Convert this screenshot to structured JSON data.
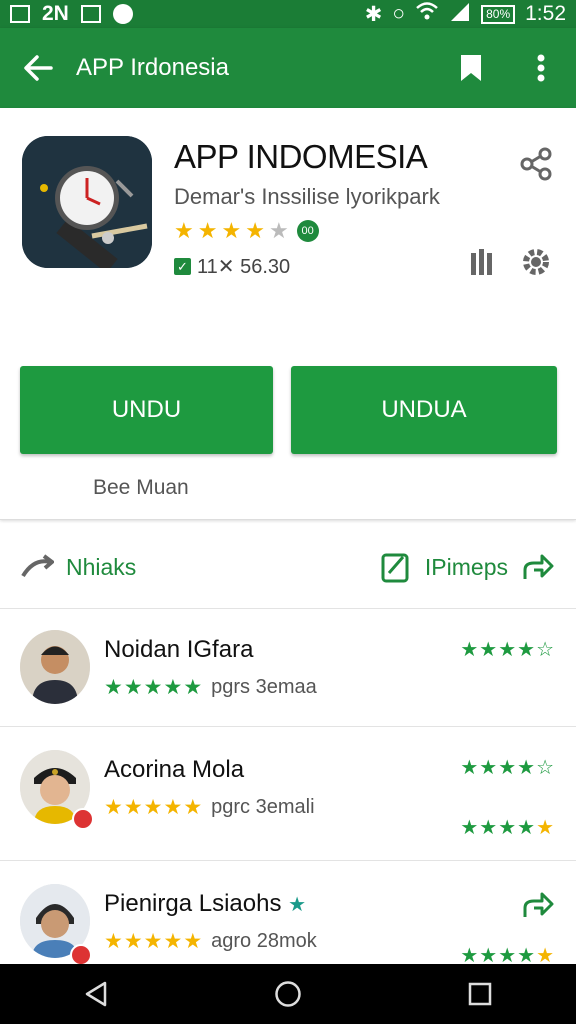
{
  "status_bar": {
    "left_text": "2N",
    "battery": "80%",
    "time": "1:52"
  },
  "app_bar": {
    "title": "APP Irdonesia"
  },
  "app": {
    "name": "APP INDOMESIA",
    "developer": "Demar's Inssilise lyorikpark",
    "rating_stars": 4,
    "age_badge": "00",
    "downloads": "11✕ 56.30"
  },
  "buttons": {
    "install_left": "UNDU",
    "install_right": "UNDUA",
    "see_more": "Bee Muan"
  },
  "section": {
    "left_label": "Nhiaks",
    "right_label": "IPimeps"
  },
  "reviews": [
    {
      "name": "Noidan IGfara",
      "meta": "pgrs 3emaa",
      "rating": 5
    },
    {
      "name": "Acorina Mola",
      "meta": "pgrc 3emali",
      "rating": 5
    },
    {
      "name": "Pienirga Lsiaohs",
      "meta": "agro 28mok",
      "rating": 5
    }
  ],
  "colors": {
    "primary": "#1f8a3d",
    "button": "#1e9a40",
    "star": "#f4b400"
  }
}
